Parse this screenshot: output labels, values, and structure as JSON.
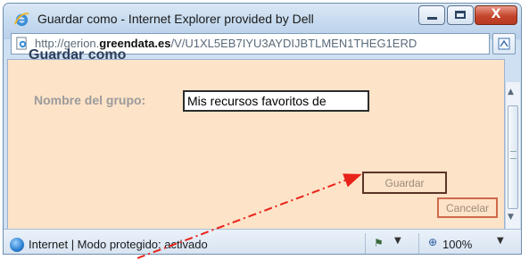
{
  "window": {
    "title": "Guardar como - Internet Explorer provided by Dell",
    "close_glyph": "X",
    "url_prefix": "http://gerion.",
    "url_domain": "greendata.es",
    "url_path": "/V/U1XL5EB7IYU3AYDIJBTLMEN1THEG1ERD"
  },
  "dialog": {
    "heading": "Guardar como",
    "group_name_label": "Nombre del grupo:",
    "group_name_value": "Mis recursos favoritos de",
    "save_label": "Guardar",
    "cancel_label": "Cancelar"
  },
  "statusbar": {
    "text": "Internet | Modo protegido: activado",
    "zoom": "100%"
  },
  "icons": {
    "window_icon": "ie-logo-icon",
    "page_icon": "page-icon",
    "status_icon": "globe-icon",
    "security_icon": "security-icon",
    "zoom_icon": "zoom-icon"
  },
  "colors": {
    "content_background": "#fde3c8",
    "annotation_arrow": "#e8231a",
    "heading": "#2d3f5c"
  }
}
